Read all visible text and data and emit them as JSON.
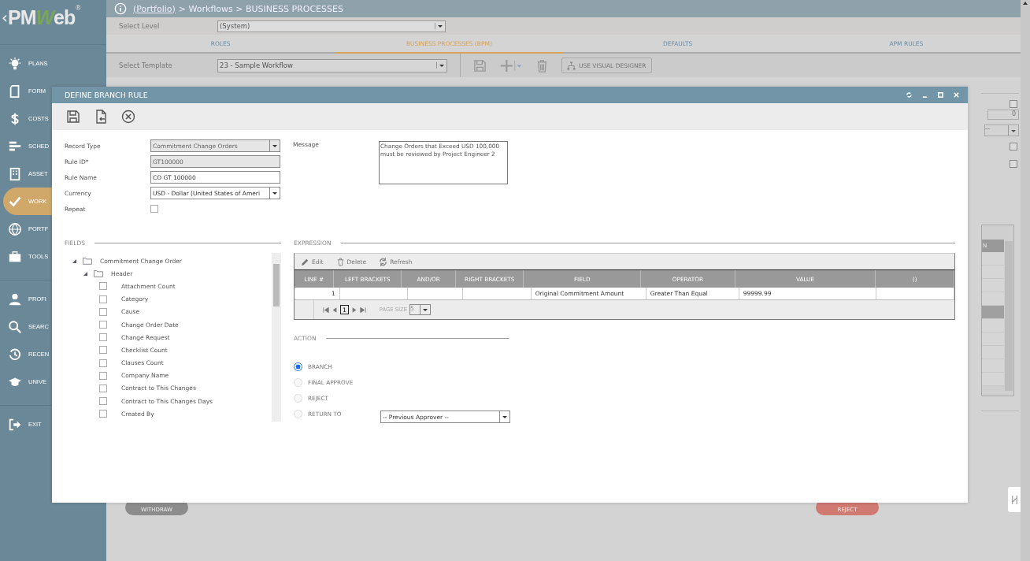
{
  "app": {
    "back": "‹",
    "logo": "PMWeb",
    "registered": "®"
  },
  "breadcrumb": {
    "link": "(Portfolio)",
    "rest": "> Workflows > BUSINESS PROCESSES"
  },
  "sidebar": {
    "items": [
      {
        "label": "PLANS",
        "selected": false
      },
      {
        "label": "FORM",
        "selected": false
      },
      {
        "label": "COSTS",
        "selected": false
      },
      {
        "label": "SCHED",
        "selected": false
      },
      {
        "label": "ASSET",
        "selected": false
      },
      {
        "label": "WORK",
        "selected": true
      },
      {
        "label": "PORTF",
        "selected": false
      },
      {
        "label": "TOOLS",
        "selected": false
      },
      {
        "label": "PROFI",
        "selected": false
      },
      {
        "label": "SEARC",
        "selected": false
      },
      {
        "label": "RECEN",
        "selected": false
      },
      {
        "label": "UNIVE",
        "selected": false
      },
      {
        "label": "EXIT",
        "selected": false
      }
    ]
  },
  "level": {
    "label": "Select Level",
    "value": "(System)"
  },
  "tabs": [
    {
      "label": "ROLES",
      "selected": false
    },
    {
      "label": "BUSINESS PROCESSES (BPM)",
      "selected": true
    },
    {
      "label": "DEFAULTS",
      "selected": false
    },
    {
      "label": "APM RULES",
      "selected": false
    }
  ],
  "template": {
    "label": "Select Template",
    "value": "23 - Sample Workflow",
    "designer": "USE VISUAL DESIGNER"
  },
  "background": {
    "field_value": "0",
    "dropdown_value": "--",
    "column_header": "N",
    "rows": [
      {
        "selected": false
      },
      {
        "selected": false
      },
      {
        "selected": false
      },
      {
        "selected": false
      },
      {
        "selected": true
      },
      {
        "selected": false
      },
      {
        "selected": false
      },
      {
        "selected": false
      },
      {
        "selected": false
      },
      {
        "selected": false
      }
    ],
    "checkboxes": [
      false,
      false,
      false
    ],
    "buttons": [
      {
        "label": "WITHDRAW",
        "kind": "withdraw"
      },
      {
        "label": "REJECT",
        "kind": "reject"
      }
    ]
  },
  "dialog": {
    "title": "DEFINE BRANCH RULE",
    "fields": [
      {
        "label": "Record Type",
        "kind": "select",
        "value": "Commitment Change Orders"
      },
      {
        "label": "Rule ID*",
        "kind": "readonly",
        "value": "GT100000"
      },
      {
        "label": "Rule Name",
        "kind": "text",
        "value": "CO GT 100000"
      },
      {
        "label": "Currency",
        "kind": "select",
        "value": "USD - Dollar (United States of Ameri"
      },
      {
        "label": "Repeat",
        "kind": "checkbox",
        "checked": false
      }
    ],
    "message": {
      "label": "Message",
      "value": "Change Orders that Exceed USD 100,000 must be reviewed by Project Engineer 2"
    },
    "fields_section": {
      "title": "FIELDS",
      "tree": [
        {
          "label": "Commitment Change Order",
          "expanded": true,
          "children": [
            {
              "label": "Header",
              "expanded": true,
              "children": [
                {
                  "label": "Attachment Count",
                  "checked": false
                },
                {
                  "label": "Category",
                  "checked": false
                },
                {
                  "label": "Cause",
                  "checked": false
                },
                {
                  "label": "Change Order Date",
                  "checked": false
                },
                {
                  "label": "Change Request",
                  "checked": false
                },
                {
                  "label": "Checklist Count",
                  "checked": false
                },
                {
                  "label": "Clauses Count",
                  "checked": false
                },
                {
                  "label": "Company Name",
                  "checked": false
                },
                {
                  "label": "Contract to This Changes",
                  "checked": false
                },
                {
                  "label": "Contract to This Changes Days",
                  "checked": false
                },
                {
                  "label": "Created By",
                  "checked": false
                }
              ]
            }
          ]
        }
      ]
    },
    "expression": {
      "title": "EXPRESSION",
      "toolbar": [
        {
          "label": "Edit",
          "kind": "edit"
        },
        {
          "label": "Delete",
          "kind": "delete"
        },
        {
          "label": "Refresh",
          "kind": "refresh"
        }
      ],
      "columns": [
        "LINE #",
        "LEFT BRACKETS",
        "AND/OR",
        "RIGHT BRACKETS",
        "FIELD",
        "OPERATOR",
        "VALUE",
        "()"
      ],
      "rows": [
        [
          "1",
          "",
          "",
          "",
          "Original Commitment Amount",
          "Greater Than Equal",
          "99999.99",
          ""
        ]
      ],
      "page": "1",
      "page_size_label": "PAGE SIZE",
      "page_size": "5"
    },
    "action": {
      "title": "ACTION",
      "options": [
        {
          "label": "BRANCH",
          "selected": true
        },
        {
          "label": "FINAL APPROVE",
          "selected": false
        },
        {
          "label": "REJECT",
          "selected": false
        },
        {
          "label": "RETURN TO",
          "selected": false
        }
      ],
      "return_to": "-- Previous Approver --"
    }
  }
}
